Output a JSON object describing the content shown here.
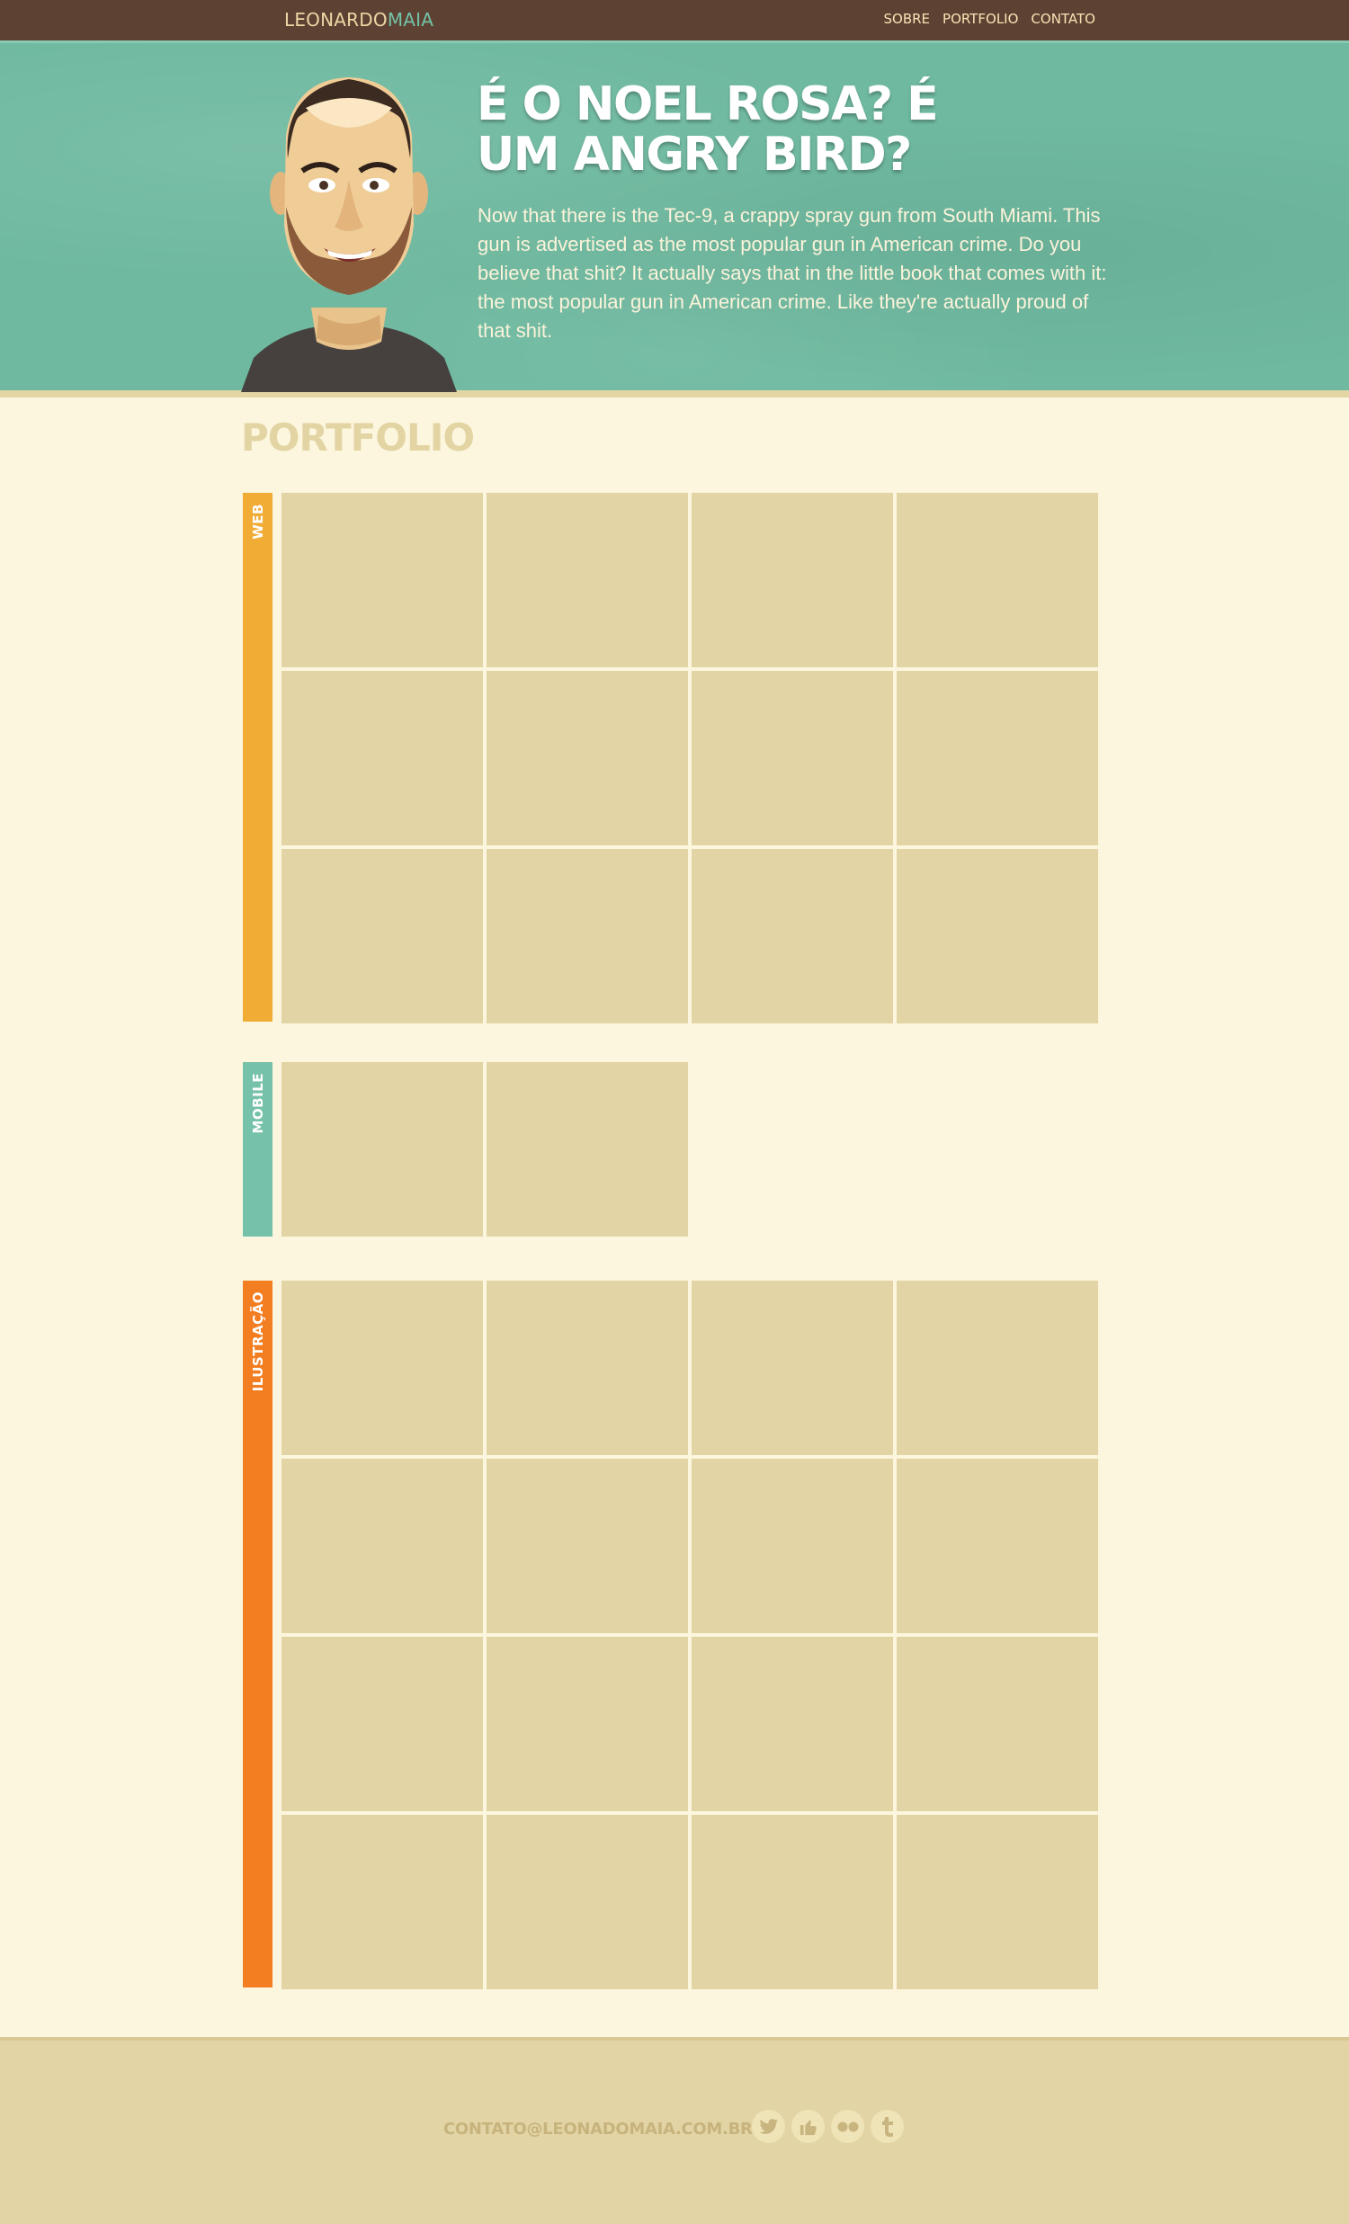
{
  "header": {
    "logo_part1": "LEONARDO",
    "logo_part2": "MAIA",
    "nav": [
      "SOBRE",
      "PORTFOLIO",
      "CONTATO"
    ]
  },
  "hero": {
    "title": "É O NOEL ROSA? É UM ANGRY BIRD?",
    "text": "Now that there is the Tec-9, a crappy spray gun from South Miami. This gun is advertised as the most popular gun in American crime. Do you believe that shit? It actually says that in the little book that comes with it: the most popular gun in American crime. Like they're actually proud of that shit."
  },
  "portfolio": {
    "title": "PORTFOLIO",
    "sections": [
      {
        "label": "WEB",
        "tiles": 12,
        "color": "#f0ac35"
      },
      {
        "label": "MOBILE",
        "tiles": 2,
        "color": "#76c1a9"
      },
      {
        "label": "ILUSTRAÇÃO",
        "tiles": 16,
        "color": "#f37e22"
      }
    ]
  },
  "footer": {
    "contact": "CONTATO@LEONADOMAIA.COM.BR",
    "socials": [
      "twitter-icon",
      "like-icon",
      "flickr-icon",
      "tumblr-icon"
    ]
  },
  "colors": {
    "topbar": "#5d4132",
    "hero": "#6fb9a0",
    "background": "#fcf6de",
    "tile": "#e2d4a4"
  }
}
